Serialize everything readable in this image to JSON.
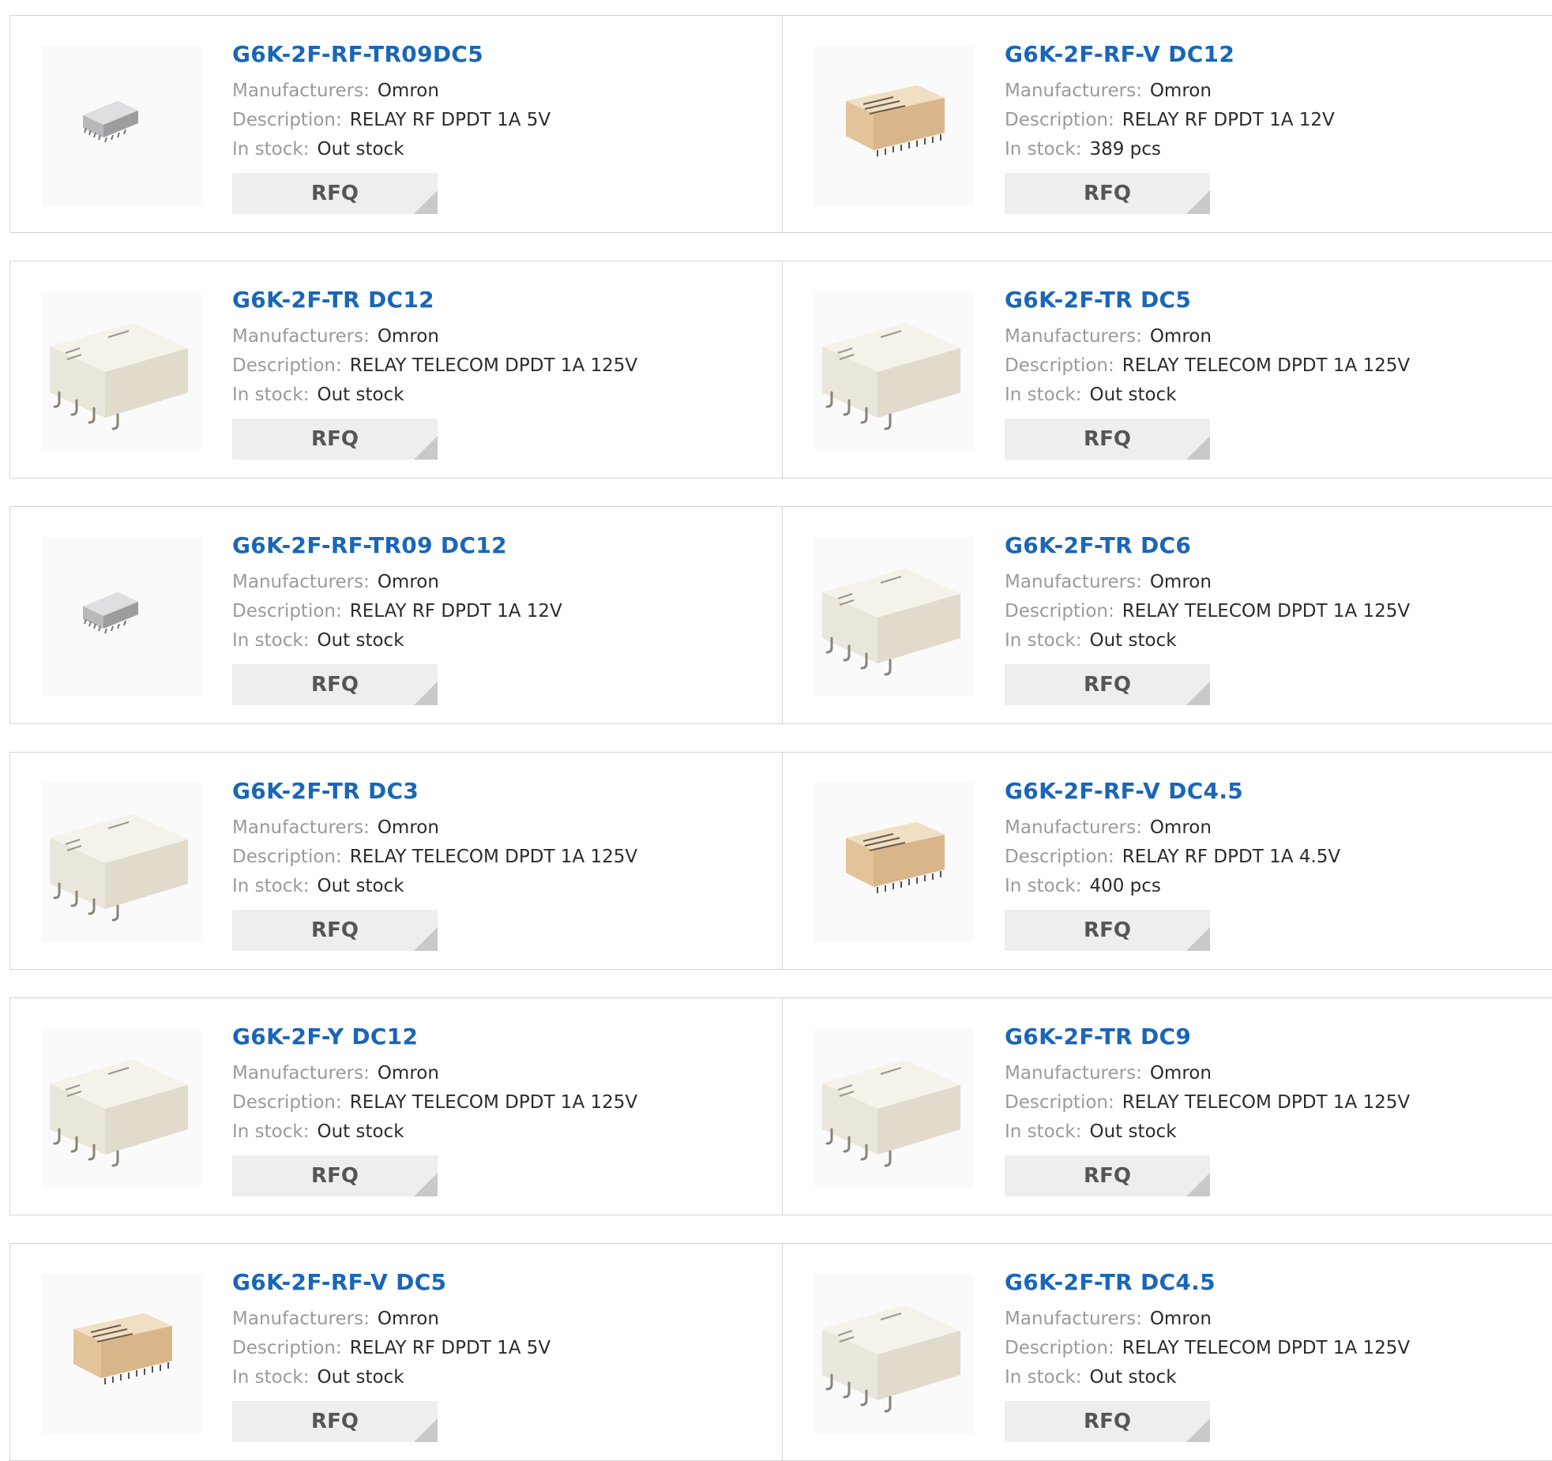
{
  "labels": {
    "manufacturers": "Manufacturers:",
    "description": "Description:",
    "stock": "In stock:",
    "rfq": "RFQ"
  },
  "products": [
    {
      "part": "G6K-2F-RF-TR09DC5",
      "manufacturer": "Omron",
      "description": "RELAY RF DPDT 1A 5V",
      "stock": "Out stock",
      "image": "relay-rf-grey-icon"
    },
    {
      "part": "G6K-2F-RF-V DC12",
      "manufacturer": "Omron",
      "description": "RELAY RF DPDT 1A 12V",
      "stock": "389 pcs",
      "image": "relay-rf-tan-icon"
    },
    {
      "part": "G6K-2F-TR DC12",
      "manufacturer": "Omron",
      "description": "RELAY TELECOM DPDT 1A 125V",
      "stock": "Out stock",
      "image": "relay-telecom-icon"
    },
    {
      "part": "G6K-2F-TR DC5",
      "manufacturer": "Omron",
      "description": "RELAY TELECOM DPDT 1A 125V",
      "stock": "Out stock",
      "image": "relay-telecom-icon"
    },
    {
      "part": "G6K-2F-RF-TR09 DC12",
      "manufacturer": "Omron",
      "description": "RELAY RF DPDT 1A 12V",
      "stock": "Out stock",
      "image": "relay-rf-grey-icon"
    },
    {
      "part": "G6K-2F-TR DC6",
      "manufacturer": "Omron",
      "description": "RELAY TELECOM DPDT 1A 125V",
      "stock": "Out stock",
      "image": "relay-telecom-icon"
    },
    {
      "part": "G6K-2F-TR DC3",
      "manufacturer": "Omron",
      "description": "RELAY TELECOM DPDT 1A 125V",
      "stock": "Out stock",
      "image": "relay-telecom-icon"
    },
    {
      "part": "G6K-2F-RF-V DC4.5",
      "manufacturer": "Omron",
      "description": "RELAY RF DPDT 1A 4.5V",
      "stock": "400 pcs",
      "image": "relay-rf-tan-icon"
    },
    {
      "part": "G6K-2F-Y DC12",
      "manufacturer": "Omron",
      "description": "RELAY TELECOM DPDT 1A 125V",
      "stock": "Out stock",
      "image": "relay-telecom-icon"
    },
    {
      "part": "G6K-2F-TR DC9",
      "manufacturer": "Omron",
      "description": "RELAY TELECOM DPDT 1A 125V",
      "stock": "Out stock",
      "image": "relay-telecom-icon"
    },
    {
      "part": "G6K-2F-RF-V DC5",
      "manufacturer": "Omron",
      "description": "RELAY RF DPDT 1A 5V",
      "stock": "Out stock",
      "image": "relay-rf-tan-icon"
    },
    {
      "part": "G6K-2F-TR DC4.5",
      "manufacturer": "Omron",
      "description": "RELAY TELECOM DPDT 1A 125V",
      "stock": "Out stock",
      "image": "relay-telecom-icon"
    }
  ],
  "colors": {
    "link": "#1a66b8",
    "label": "#9a9a9a",
    "value": "#2b2b2b",
    "button_bg": "#eeeeee",
    "border": "#d4d4d4"
  }
}
